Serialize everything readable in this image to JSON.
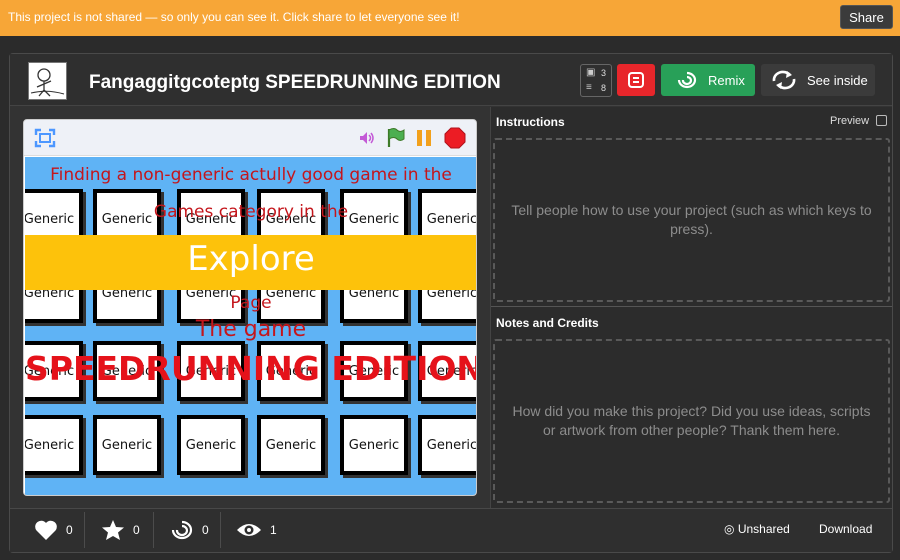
{
  "banner": {
    "message": "This project is not shared — so only you can see it. Click share to let everyone see it!",
    "share_label": "Share"
  },
  "project": {
    "title": "Fangaggitgcoteptg SPEEDRUNNING EDITION",
    "sprite_count": "3",
    "script_count": "8"
  },
  "actions": {
    "remix_label": "Remix",
    "see_inside_label": "See inside"
  },
  "stage": {
    "tile_label": "Generic",
    "line1": "Finding a non-generic actully good game in the",
    "line2": "Games category in the",
    "explore": "Explore",
    "line3": "Page",
    "line4": "The game",
    "line5": "SPEEDRUNNING EDITION"
  },
  "instructions": {
    "title": "Instructions",
    "preview_label": "Preview",
    "placeholder": "Tell people how to use your project (such as which keys to press)."
  },
  "notes": {
    "title": "Notes and Credits",
    "placeholder": "How did you make this project? Did you use ideas, scripts or artwork from other people? Thank them here."
  },
  "stats": {
    "loves": "0",
    "favorites": "0",
    "remixes": "0",
    "views": "1"
  },
  "footer": {
    "unshared_label": "Unshared",
    "download_label": "Download"
  },
  "colors": {
    "banner": "#f7a637",
    "remix": "#28a058",
    "stop": "#e8262b",
    "stage_bg": "#5fb3f5",
    "explore_band": "#fdc20b",
    "stage_text": "#c4161c"
  }
}
